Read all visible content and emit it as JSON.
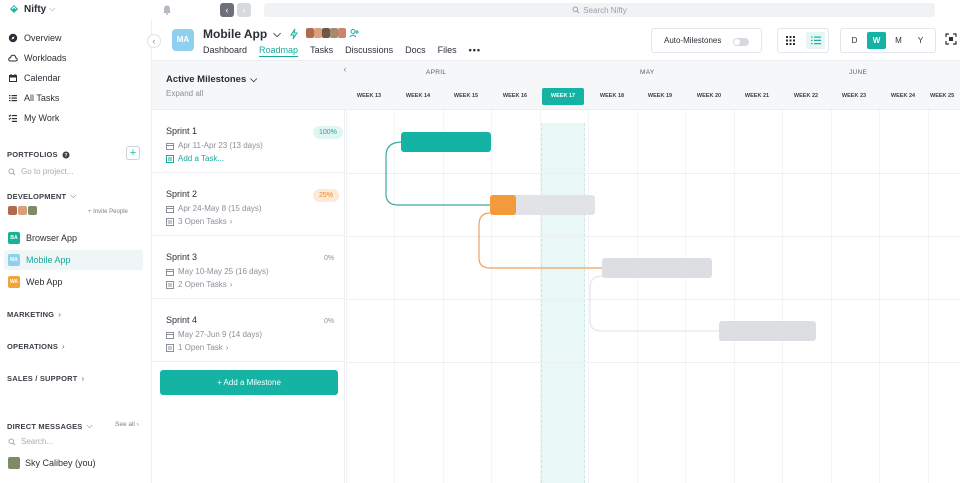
{
  "app": {
    "name": "Nifty",
    "search_placeholder": "Search Nifty"
  },
  "sidebar": {
    "nav": [
      {
        "label": "Overview",
        "icon": "compass-icon"
      },
      {
        "label": "Workloads",
        "icon": "cloud-icon"
      },
      {
        "label": "Calendar",
        "icon": "calendar-icon"
      },
      {
        "label": "All Tasks",
        "icon": "list-icon"
      },
      {
        "label": "My Work",
        "icon": "checklist-icon"
      }
    ],
    "portfolios_label": "PORTFOLIOS",
    "project_search_placeholder": "Go to project...",
    "development_label": "DEVELOPMENT",
    "invite_label": "+ Invite People",
    "projects": [
      {
        "initials": "BA",
        "label": "Browser App",
        "color": "#19b394"
      },
      {
        "initials": "MA",
        "label": "Mobile App",
        "color": "#8fcff0"
      },
      {
        "initials": "WA",
        "label": "Web App",
        "color": "#f0a53c"
      }
    ],
    "groups": [
      "MARKETING",
      "OPERATIONS",
      "SALES / SUPPORT"
    ],
    "dm_label": "DIRECT MESSAGES",
    "see_all": "See all",
    "dm_search_placeholder": "Search...",
    "dm_user": "Sky Calibey (you)"
  },
  "project": {
    "initials": "MA",
    "title": "Mobile App",
    "tabs": [
      "Dashboard",
      "Roadmap",
      "Tasks",
      "Discussions",
      "Docs",
      "Files"
    ],
    "more": "•••",
    "active_tab": "Roadmap"
  },
  "controls": {
    "auto_milestones_label": "Auto-Milestones",
    "auto_milestones_on": false,
    "scale_buttons": [
      "D",
      "W",
      "M",
      "Y"
    ],
    "active_scale": "W",
    "active_view": "list"
  },
  "milestones": {
    "header": "Active Milestones",
    "expand_all": "Expand all",
    "add_button": "+ Add a Milestone",
    "items": [
      {
        "name": "Sprint 1",
        "percent": "100%",
        "dates": "Apr 11-Apr 23 (13 days)",
        "task_link": "Add a Task...",
        "color": "#14b3a3"
      },
      {
        "name": "Sprint 2",
        "percent": "25%",
        "dates": "Apr 24-May 8 (15 days)",
        "task_link": "3 Open Tasks",
        "color": "#f39a3a"
      },
      {
        "name": "Sprint 3",
        "percent": "0%",
        "dates": "May 10-May 25 (16 days)",
        "task_link": "2 Open Tasks",
        "color": "#d8dadd"
      },
      {
        "name": "Sprint 4",
        "percent": "0%",
        "dates": "May 27-Jun 9 (14 days)",
        "task_link": "1 Open Task",
        "color": "#d8dadd"
      }
    ]
  },
  "timeline": {
    "months": [
      "APRIL",
      "MAY",
      "JUNE"
    ],
    "weeks": [
      "WEEK 13",
      "WEEK 14",
      "WEEK 15",
      "WEEK 16",
      "WEEK 17",
      "WEEK 18",
      "WEEK 19",
      "WEEK 20",
      "WEEK 21",
      "WEEK 22",
      "WEEK 23",
      "WEEK 24",
      "WEEK 25"
    ],
    "current_week": "WEEK 17"
  },
  "colors": {
    "accent": "#14b3a3",
    "orange": "#f39a3a",
    "gray_bar": "#dcdee1"
  }
}
